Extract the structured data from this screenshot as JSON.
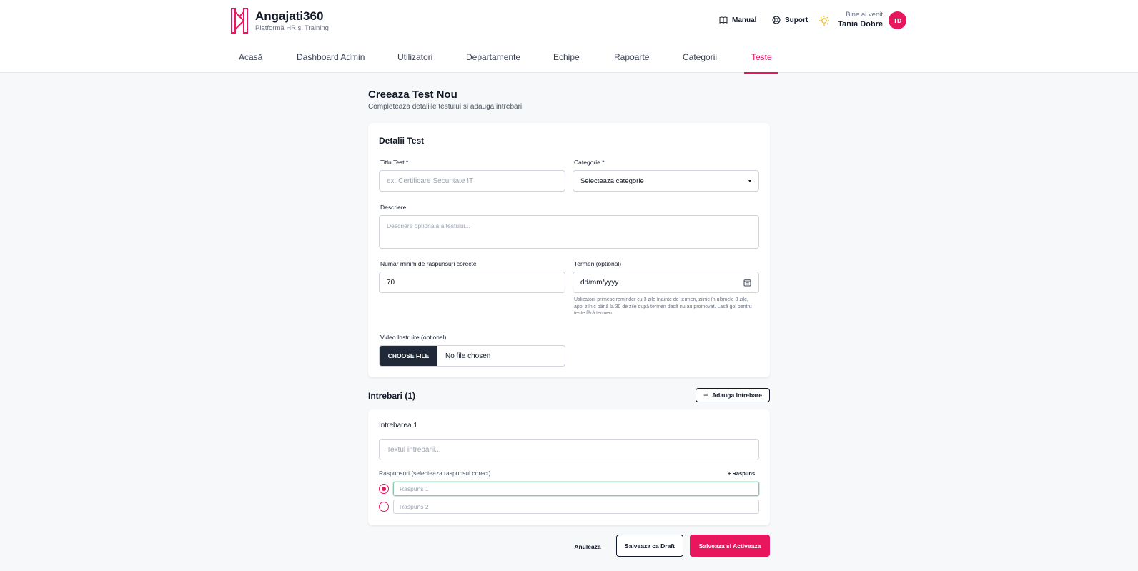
{
  "brand": {
    "name": "Angajati360",
    "tagline": "Platformă HR și Training"
  },
  "header": {
    "manual_label": "Manual",
    "support_label": "Suport",
    "welcome_text": "Bine ai venit",
    "user_name": "Tania Dobre",
    "avatar_initials": "TD"
  },
  "nav": {
    "items": [
      {
        "label": "Acasă"
      },
      {
        "label": "Dashboard Admin"
      },
      {
        "label": "Utilizatori"
      },
      {
        "label": "Departamente"
      },
      {
        "label": "Echipe"
      },
      {
        "label": "Rapoarte"
      },
      {
        "label": "Categorii"
      },
      {
        "label": "Teste"
      }
    ],
    "active": "Teste"
  },
  "page": {
    "title": "Creeaza Test Nou",
    "subtitle": "Completeaza detaliile testului si adauga intrebari"
  },
  "details": {
    "section_title": "Detalii Test",
    "title_label": "Titlu Test *",
    "title_placeholder": "ex: Certificare Securitate IT",
    "category_label": "Categorie *",
    "category_value": "Selecteaza categorie",
    "description_label": "Descriere",
    "description_placeholder": "Descriere optionala a testului...",
    "min_correct_label": "Numar minim de raspunsuri corecte",
    "min_correct_value": "70",
    "deadline_label": "Termen (optional)",
    "deadline_placeholder": "dd/mm/yyyy",
    "deadline_hint": "Utilizatorii primesc reminder cu 3 zile înainte de termen, zilnic în ultimele 3 zile, apoi zilnic până la 30 de zile după termen dacă nu au promovat. Lasă gol pentru teste fără termen.",
    "video_label": "Video Instruire (optional)",
    "choose_file_label": "CHOOSE FILE",
    "file_status": "No file chosen"
  },
  "questions": {
    "header": "Intrebari (1)",
    "add_button_label": "Adauga Intrebare",
    "items": [
      {
        "label": "Intrebarea 1",
        "text_placeholder": "Textul intrebarii...",
        "answers_label": "Raspunsuri (selecteaza raspunsul corect)",
        "add_answer_label": "+ Raspuns",
        "answers": [
          {
            "placeholder": "Raspuns 1",
            "selected": true
          },
          {
            "placeholder": "Raspuns 2",
            "selected": false
          }
        ]
      }
    ]
  },
  "actions": {
    "cancel_label": "Anuleaza",
    "draft_label": "Salveaza ca Draft",
    "activate_label": "Salveaza si Activeaza"
  },
  "colors": {
    "accent": "#e8175d",
    "dark": "#1f2937",
    "background": "#f7f8fa"
  }
}
